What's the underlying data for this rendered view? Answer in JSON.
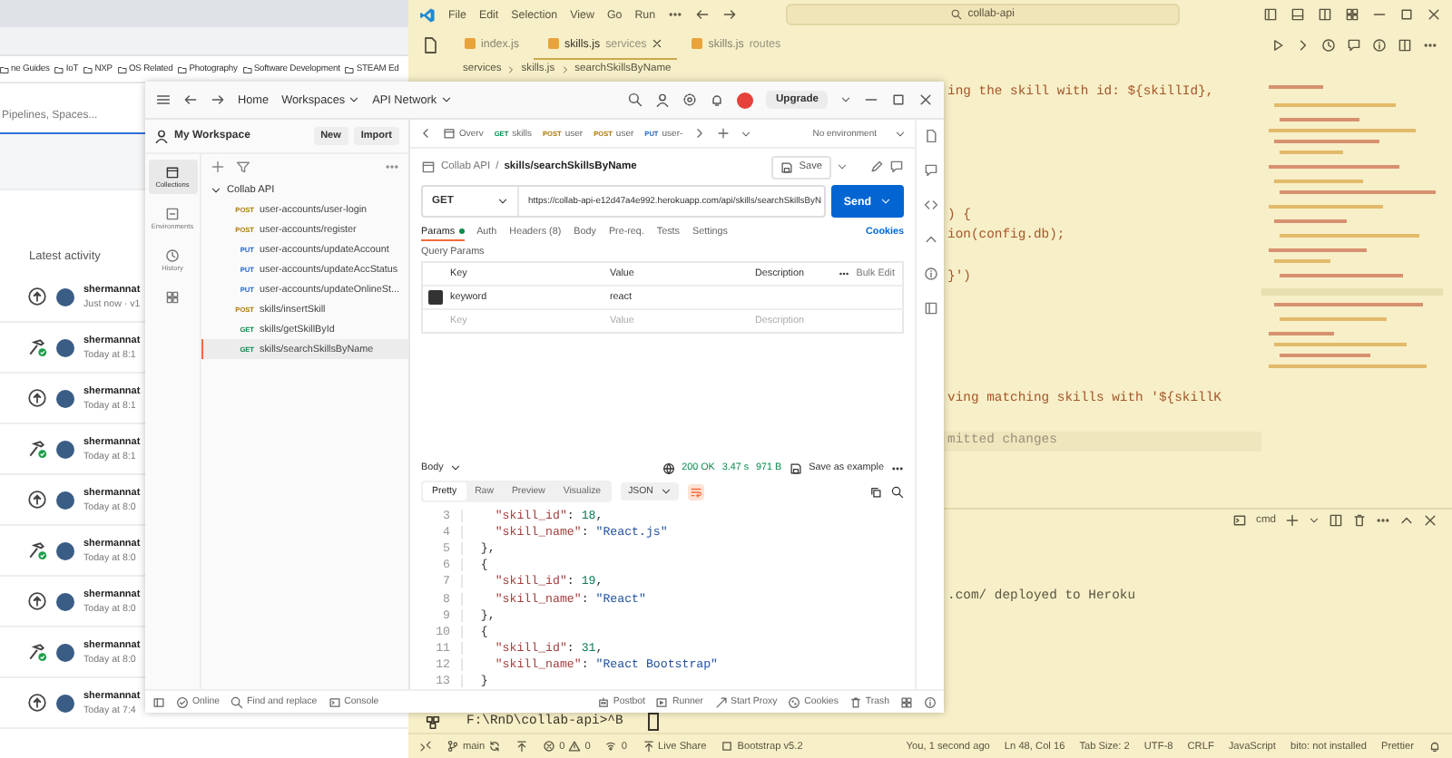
{
  "browser": {
    "bookmarks": [
      "ne Guides",
      "IoT",
      "NXP",
      "OS Related",
      "Photography",
      "Software Development",
      "STEAM Ed"
    ],
    "search": {
      "placeholder": "Pipelines, Spaces..."
    },
    "activity_title": "Latest activity",
    "activity": [
      {
        "kind": "upload",
        "user": "shermannat",
        "time": "Just now · v1"
      },
      {
        "kind": "build",
        "user": "shermannat",
        "time": "Today at 8:1"
      },
      {
        "kind": "upload",
        "user": "shermannat",
        "time": "Today at 8:1"
      },
      {
        "kind": "build",
        "user": "shermannat",
        "time": "Today at 8:1"
      },
      {
        "kind": "upload",
        "user": "shermannat",
        "time": "Today at 8:0"
      },
      {
        "kind": "build",
        "user": "shermannat",
        "time": "Today at 8:0"
      },
      {
        "kind": "upload",
        "user": "shermannat",
        "time": "Today at 8:0"
      },
      {
        "kind": "build",
        "user": "shermannat",
        "time": "Today at 8:0"
      },
      {
        "kind": "upload",
        "user": "shermannat",
        "time": "Today at 7:4"
      }
    ]
  },
  "postman": {
    "nav": [
      "Home",
      "Workspaces",
      "API Network"
    ],
    "upgrade": "Upgrade",
    "workspace": {
      "title": "My Workspace",
      "buttons": [
        "New",
        "Import"
      ]
    },
    "rail": [
      {
        "kind": "collections",
        "label": "Collections",
        "selected": true
      },
      {
        "kind": "environments",
        "label": "Environments",
        "selected": false
      },
      {
        "kind": "history",
        "label": "History",
        "selected": false
      },
      {
        "kind": "apps",
        "selected": false
      }
    ],
    "collection": {
      "name": "Collab API",
      "expanded": true,
      "items": [
        {
          "method": "POST",
          "name": "user-accounts/user-login",
          "selected": false
        },
        {
          "method": "POST",
          "name": "user-accounts/register",
          "selected": false
        },
        {
          "method": "PUT",
          "name": "user-accounts/updateAccount",
          "selected": false
        },
        {
          "method": "PUT",
          "name": "user-accounts/updateAccStatus",
          "selected": false
        },
        {
          "method": "PUT",
          "name": "user-accounts/updateOnlineSt...",
          "selected": false
        },
        {
          "method": "POST",
          "name": "skills/insertSkill",
          "selected": false
        },
        {
          "method": "GET",
          "name": "skills/getSkillById",
          "selected": false
        },
        {
          "method": "GET",
          "name": "skills/searchSkillsByName",
          "selected": true
        }
      ]
    },
    "tabs": [
      {
        "kind": "overview",
        "label": "Overv"
      },
      {
        "kind": "request",
        "method": "GET",
        "label": "skills"
      },
      {
        "kind": "request",
        "method": "POST",
        "label": "user"
      },
      {
        "kind": "request",
        "method": "POST",
        "label": "user"
      },
      {
        "kind": "request",
        "method": "PUT",
        "label": "user-"
      }
    ],
    "environment": "No environment",
    "breadcrumb": [
      "Collab API",
      "skills/searchSkillsByName"
    ],
    "breadcrumb_separator": "/",
    "save": "Save",
    "request": {
      "method": "GET",
      "url": "https://collab-api-e12d47a4e992.herokuapp.com/api/skills/searchSkillsByN",
      "send": "Send"
    },
    "request_tabs": [
      {
        "label": "Params",
        "selected": true,
        "has_content": true
      },
      {
        "label": "Auth",
        "selected": false,
        "has_content": false
      },
      {
        "label": "Headers (8)",
        "selected": false,
        "has_content": false
      },
      {
        "label": "Body",
        "selected": false,
        "has_content": false
      },
      {
        "label": "Pre-req.",
        "selected": false,
        "has_content": false
      },
      {
        "label": "Tests",
        "selected": false,
        "has_content": false
      },
      {
        "label": "Settings",
        "selected": false,
        "has_content": false
      }
    ],
    "cookies": "Cookies",
    "params": {
      "title": "Query Params",
      "columns": [
        "Key",
        "Value",
        "Description"
      ],
      "bulk_edit": "Bulk Edit",
      "rows": [
        {
          "checked": true,
          "key": "keyword",
          "value": "react"
        }
      ],
      "new_row": {
        "key": "Key",
        "value": "Value",
        "description": "Description"
      }
    },
    "response": {
      "label": "Body",
      "status": "200 OK",
      "time": "3.47 s",
      "size": "971 B",
      "save_example": "Save as example",
      "views": [
        {
          "label": "Pretty",
          "selected": true
        },
        {
          "label": "Raw",
          "selected": false
        },
        {
          "label": "Preview",
          "selected": false
        },
        {
          "label": "Visualize",
          "selected": false
        }
      ],
      "format": "JSON",
      "wrap_lines": true,
      "lines": [
        {
          "n": "3",
          "text": "    \"skill_id\": 18,"
        },
        {
          "n": "4",
          "text": "    \"skill_name\": \"React.js\""
        },
        {
          "n": "5",
          "text": "  },"
        },
        {
          "n": "6",
          "text": "  {"
        },
        {
          "n": "7",
          "text": "    \"skill_id\": 19,"
        },
        {
          "n": "8",
          "text": "    \"skill_name\": \"React\""
        },
        {
          "n": "9",
          "text": "  },"
        },
        {
          "n": "10",
          "text": "  {"
        },
        {
          "n": "11",
          "text": "    \"skill_id\": 31,"
        },
        {
          "n": "12",
          "text": "    \"skill_name\": \"React Bootstrap\""
        },
        {
          "n": "13",
          "text": "  }"
        }
      ]
    },
    "footer_left": [
      "Online",
      "Find and replace",
      "Console"
    ],
    "footer_right": [
      "Postbot",
      "Runner",
      "Start Proxy",
      "Cookies",
      "Trash"
    ]
  },
  "vscode": {
    "menu": [
      "File",
      "Edit",
      "Selection",
      "View",
      "Go",
      "Run"
    ],
    "search": "collab-api",
    "tabs": [
      {
        "label": "index.js",
        "selected": false
      },
      {
        "label": "skills.js",
        "detail": "services",
        "selected": true
      },
      {
        "label": "skills.js",
        "detail": "routes",
        "selected": false
      }
    ],
    "breadcrumb": [
      "services",
      "skills.js",
      "searchSkillsByName"
    ],
    "lines": [
      {
        "kind": "code",
        "text": "ing the skill with id: ${skillId},",
        "current": false
      },
      {
        "kind": "blank",
        "current": false
      },
      {
        "kind": "blank",
        "current": false
      },
      {
        "kind": "blank",
        "current": false
      },
      {
        "kind": "blank",
        "current": false
      },
      {
        "kind": "blank",
        "current": false
      },
      {
        "kind": "code",
        "text": ") {",
        "current": false
      },
      {
        "kind": "code",
        "text": "ion(config.db);",
        "current": false
      },
      {
        "kind": "blank",
        "current": false
      },
      {
        "kind": "code",
        "text": "}')",
        "current": false
      },
      {
        "kind": "blank",
        "current": false
      },
      {
        "kind": "blank",
        "current": false
      },
      {
        "kind": "blank",
        "current": false
      },
      {
        "kind": "blank",
        "current": false
      },
      {
        "kind": "blank",
        "current": false
      },
      {
        "kind": "code",
        "text": "ving matching skills with '${skillK",
        "current": false
      },
      {
        "kind": "blank",
        "current": false
      },
      {
        "kind": "ghost",
        "text": "mitted changes",
        "current": true
      }
    ],
    "terminal": {
      "shell": "cmd",
      "output_fragment": ".com/ deployed to Heroku",
      "prompt": "F:\\RnD\\collab-api>^B"
    },
    "status_left": {
      "branch": "main",
      "errors": "0",
      "warnings": "0",
      "ports": "0",
      "live_share": "Live Share",
      "extension": "Bootstrap v5.2"
    },
    "status_right": [
      "You, 1 second ago",
      "Ln 48, Col 16",
      "Tab Size: 2",
      "UTF-8",
      "CRLF",
      "JavaScript",
      "bito: not installed",
      "Prettier"
    ]
  }
}
